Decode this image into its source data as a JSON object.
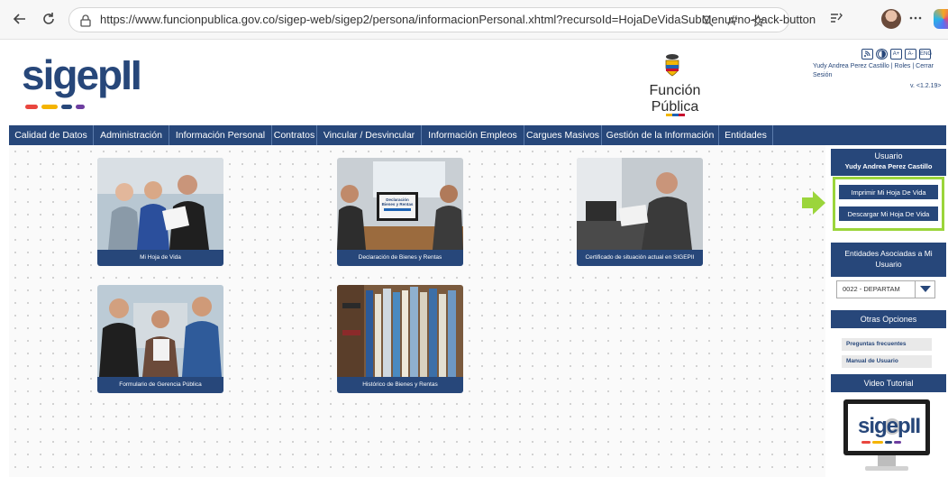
{
  "browser": {
    "url": "https://www.funcionpublica.gov.co/sigep-web/sigep2/persona/informacionPersonal.xhtml?recursoId=HojaDeVidaSubMenu#no-back-button",
    "read_aloud_label": "Aʹ"
  },
  "header": {
    "logo_text": "sigepII",
    "agency_name": "Función Pública",
    "accessibility_buttons": [
      "A+",
      "A-",
      "ENG"
    ],
    "user_line": "Yudy Andrea Perez Castillo | Roles | Cerrar",
    "user_line2": "Sesión",
    "version": "v. <1.2.19>"
  },
  "nav": {
    "items": [
      "Calidad de Datos",
      "Administración",
      "Información Personal",
      "Contratos",
      "Vincular / Desvincular",
      "Información Empleos",
      "Cargues Masivos",
      "Gestión de la Información",
      "Entidades"
    ]
  },
  "cards": [
    {
      "caption": "Mi Hoja de Vida"
    },
    {
      "caption": "Declaración de Bienes y Rentas"
    },
    {
      "caption": "Certificado de situación actual en SIGEPII"
    },
    {
      "caption": "Formulario de Gerencia Pública"
    },
    {
      "caption": "Histórico de Bienes y Rentas"
    }
  ],
  "declaracion_sign": "Declaración Bienes y Rentas",
  "sidebar": {
    "user_title": "Usuario",
    "user_name": "Yudy Andrea Perez Castillo",
    "print_button": "Imprimir Mi Hoja De Vida",
    "download_button": "Descargar Mi Hoja De Vida",
    "entities_title": "Entidades Asociadas a Mi Usuario",
    "entity_selected": "0022 - DEPARTAM",
    "other_options_title": "Otras Opciones",
    "links": [
      "Preguntas frecuentes",
      "Manual de Usuario"
    ],
    "video_title": "Video Tutorial",
    "video_logo": "sigepII"
  },
  "colors": {
    "brand_blue": "#27477a",
    "highlight_green": "#9bd53b"
  }
}
